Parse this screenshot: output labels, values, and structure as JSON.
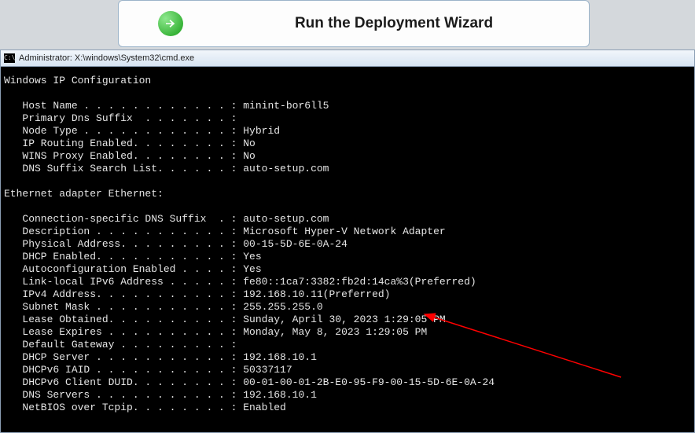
{
  "wizard": {
    "title": "Run the Deployment Wizard"
  },
  "cmd": {
    "icon_label": "C:\\",
    "title": "Administrator: X:\\windows\\System32\\cmd.exe"
  },
  "ipconfig": {
    "header": "Windows IP Configuration",
    "host_name_label": "   Host Name . . . . . . . . . . . . : ",
    "host_name": "minint-bor6ll5",
    "primary_dns_label": "   Primary Dns Suffix  . . . . . . . :",
    "node_type_label": "   Node Type . . . . . . . . . . . . : ",
    "node_type": "Hybrid",
    "ip_routing_label": "   IP Routing Enabled. . . . . . . . : ",
    "ip_routing": "No",
    "wins_proxy_label": "   WINS Proxy Enabled. . . . . . . . : ",
    "wins_proxy": "No",
    "dns_suffix_list_label": "   DNS Suffix Search List. . . . . . : ",
    "dns_suffix_list": "auto-setup.com",
    "adapter_header": "Ethernet adapter Ethernet:",
    "conn_dns_label": "   Connection-specific DNS Suffix  . : ",
    "conn_dns": "auto-setup.com",
    "description_label": "   Description . . . . . . . . . . . : ",
    "description": "Microsoft Hyper-V Network Adapter",
    "physical_label": "   Physical Address. . . . . . . . . : ",
    "physical": "00-15-5D-6E-0A-24",
    "dhcp_enabled_label": "   DHCP Enabled. . . . . . . . . . . : ",
    "dhcp_enabled": "Yes",
    "autoconfig_label": "   Autoconfiguration Enabled . . . . : ",
    "autoconfig": "Yes",
    "linklocal_label": "   Link-local IPv6 Address . . . . . : ",
    "linklocal": "fe80::1ca7:3382:fb2d:14ca%3(Preferred)",
    "ipv4_label": "   IPv4 Address. . . . . . . . . . . : ",
    "ipv4": "192.168.10.11(Preferred)",
    "subnet_label": "   Subnet Mask . . . . . . . . . . . : ",
    "subnet": "255.255.255.0",
    "lease_obt_label": "   Lease Obtained. . . . . . . . . . : ",
    "lease_obt": "Sunday, April 30, 2023 1:29:05 PM",
    "lease_exp_label": "   Lease Expires . . . . . . . . . . : ",
    "lease_exp": "Monday, May 8, 2023 1:29:05 PM",
    "default_gw_label": "   Default Gateway . . . . . . . . . :",
    "dhcp_server_label": "   DHCP Server . . . . . . . . . . . : ",
    "dhcp_server": "192.168.10.1",
    "dhcpv6_iaid_label": "   DHCPv6 IAID . . . . . . . . . . . : ",
    "dhcpv6_iaid": "50337117",
    "dhcpv6_duid_label": "   DHCPv6 Client DUID. . . . . . . . : ",
    "dhcpv6_duid": "00-01-00-01-2B-E0-95-F9-00-15-5D-6E-0A-24",
    "dns_servers_label": "   DNS Servers . . . . . . . . . . . : ",
    "dns_servers": "192.168.10.1",
    "netbios_label": "   NetBIOS over Tcpip. . . . . . . . : ",
    "netbios": "Enabled"
  }
}
